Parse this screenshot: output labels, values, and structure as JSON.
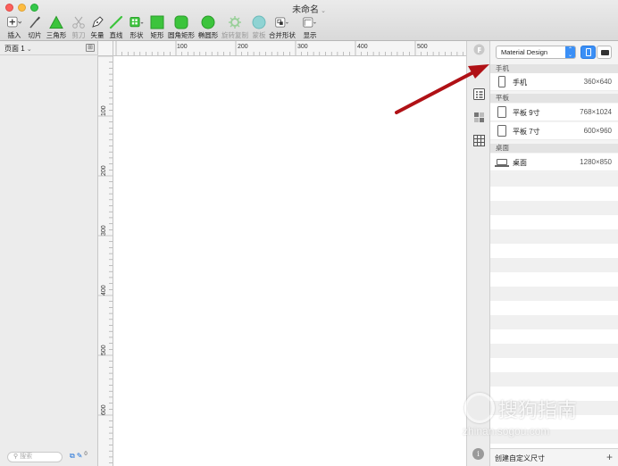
{
  "window": {
    "title": "未命名"
  },
  "toolbar": {
    "items": [
      {
        "label": "插入",
        "icon": "plus-icon"
      },
      {
        "label": "切片",
        "icon": "slice-knife-icon"
      },
      {
        "label": "三角形",
        "icon": "triangle-icon"
      },
      {
        "label": "剪刀",
        "icon": "scissors-icon"
      },
      {
        "label": "矢量",
        "icon": "pen-vector-icon"
      },
      {
        "label": "直线",
        "icon": "line-icon"
      },
      {
        "label": "形状",
        "icon": "shapes-icon"
      },
      {
        "label": "矩形",
        "icon": "rectangle-icon"
      },
      {
        "label": "圆角矩形",
        "icon": "rounded-rectangle-icon"
      },
      {
        "label": "椭圆形",
        "icon": "oval-icon"
      },
      {
        "label": "旋转复制",
        "icon": "rotate-copies-icon"
      },
      {
        "label": "蒙板",
        "icon": "mask-icon"
      },
      {
        "label": "合并形状",
        "icon": "combine-shapes-icon"
      },
      {
        "label": "显示",
        "icon": "view-icon"
      }
    ]
  },
  "pages": {
    "current": "页面 1"
  },
  "search": {
    "placeholder": "搜索"
  },
  "ruler": {
    "top_labels": [
      "100",
      "200",
      "300",
      "400",
      "500"
    ],
    "left_labels": [
      "100",
      "200",
      "300",
      "400",
      "500",
      "600"
    ]
  },
  "inspector": {
    "preset": "Material Design",
    "groups": [
      {
        "title": "手机",
        "items": [
          {
            "name": "手机",
            "size": "360×640",
            "kind": "phone"
          }
        ]
      },
      {
        "title": "平板",
        "items": [
          {
            "name": "平板 9寸",
            "size": "768×1024",
            "kind": "tablet"
          },
          {
            "name": "平板 7寸",
            "size": "600×960",
            "kind": "tablet"
          }
        ]
      },
      {
        "title": "桌面",
        "items": [
          {
            "name": "桌面",
            "size": "1280×850",
            "kind": "laptop"
          }
        ]
      }
    ],
    "create_custom": "创建自定义尺寸"
  },
  "watermark": {
    "brand": "搜狗指南",
    "url": "zhinan.sogou.com"
  },
  "colors": {
    "accent": "#3a8ff6",
    "arrow": "#b01116",
    "shape_green": "#3cc43c"
  }
}
